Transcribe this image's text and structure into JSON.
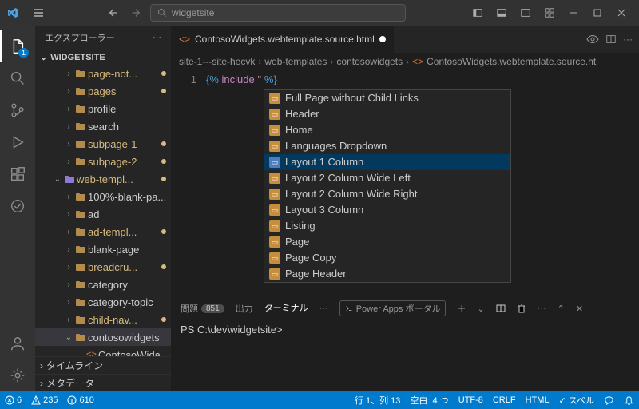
{
  "titlebar": {
    "search_placeholder": "widgetsite"
  },
  "activitybar": {
    "explorer_badge": "1"
  },
  "sidebar": {
    "title": "エクスプローラー",
    "workspace": "WIDGETSITE",
    "tree": [
      {
        "label": "page-not...",
        "depth": 2,
        "mod": true,
        "exp": false,
        "folder": true
      },
      {
        "label": "pages",
        "depth": 2,
        "mod": true,
        "exp": false,
        "folder": true
      },
      {
        "label": "profile",
        "depth": 2,
        "mod": false,
        "exp": false,
        "folder": true
      },
      {
        "label": "search",
        "depth": 2,
        "mod": false,
        "exp": false,
        "folder": true
      },
      {
        "label": "subpage-1",
        "depth": 2,
        "mod": true,
        "exp": false,
        "folder": true
      },
      {
        "label": "subpage-2",
        "depth": 2,
        "mod": true,
        "exp": false,
        "folder": true
      },
      {
        "label": "web-templ...",
        "depth": 1,
        "mod": true,
        "exp": true,
        "folder": true,
        "purple": true
      },
      {
        "label": "100%-blank-pa...",
        "depth": 2,
        "mod": false,
        "exp": false,
        "folder": true
      },
      {
        "label": "ad",
        "depth": 2,
        "mod": false,
        "exp": false,
        "folder": true
      },
      {
        "label": "ad-templ...",
        "depth": 2,
        "mod": true,
        "exp": false,
        "folder": true
      },
      {
        "label": "blank-page",
        "depth": 2,
        "mod": false,
        "exp": false,
        "folder": true
      },
      {
        "label": "breadcru...",
        "depth": 2,
        "mod": true,
        "exp": false,
        "folder": true
      },
      {
        "label": "category",
        "depth": 2,
        "mod": false,
        "exp": false,
        "folder": true
      },
      {
        "label": "category-topic",
        "depth": 2,
        "mod": false,
        "exp": false,
        "folder": true
      },
      {
        "label": "child-nav...",
        "depth": 2,
        "mod": true,
        "exp": false,
        "folder": true
      },
      {
        "label": "contosowidgets",
        "depth": 2,
        "mod": false,
        "exp": true,
        "folder": true,
        "selected": true
      },
      {
        "label": "ContosoWida",
        "depth": 3,
        "mod": false,
        "exp": false,
        "folder": false,
        "fileicon": true
      }
    ],
    "footer": {
      "timeline": "タイムライン",
      "metadata": "メタデータ"
    }
  },
  "editor": {
    "tab_label": "ContosoWidgets.webtemplate.source.html",
    "breadcrumbs": [
      "site-1---site-hecvk",
      "web-templates",
      "contosowidgets",
      "ContosoWidgets.webtemplate.source.ht"
    ],
    "line_number": "1",
    "code_tokens": {
      "open": "{%",
      "kw": " include ",
      "str": "''",
      "close": " %}"
    },
    "suggestions": [
      "Full Page without Child Links",
      "Header",
      "Home",
      "Languages Dropdown",
      "Layout 1 Column",
      "Layout 2 Column Wide Left",
      "Layout 2 Column Wide Right",
      "Layout 3 Column",
      "Listing",
      "Page",
      "Page Copy",
      "Page Header"
    ],
    "suggest_selected": 4
  },
  "panel": {
    "tabs": {
      "problems": "問題",
      "problems_count": "851",
      "output": "出力",
      "terminal": "ターミナル"
    },
    "terminal_label": "Power Apps ポータル",
    "prompt": "PS C:\\dev\\widgetsite>"
  },
  "statusbar": {
    "errors": "6",
    "warnings": "235",
    "info": "610",
    "line_col": "行 1、列 13",
    "spaces": "空白: 4 つ",
    "encoding": "UTF-8",
    "eol": "CRLF",
    "lang": "HTML",
    "spell": "スペル"
  }
}
